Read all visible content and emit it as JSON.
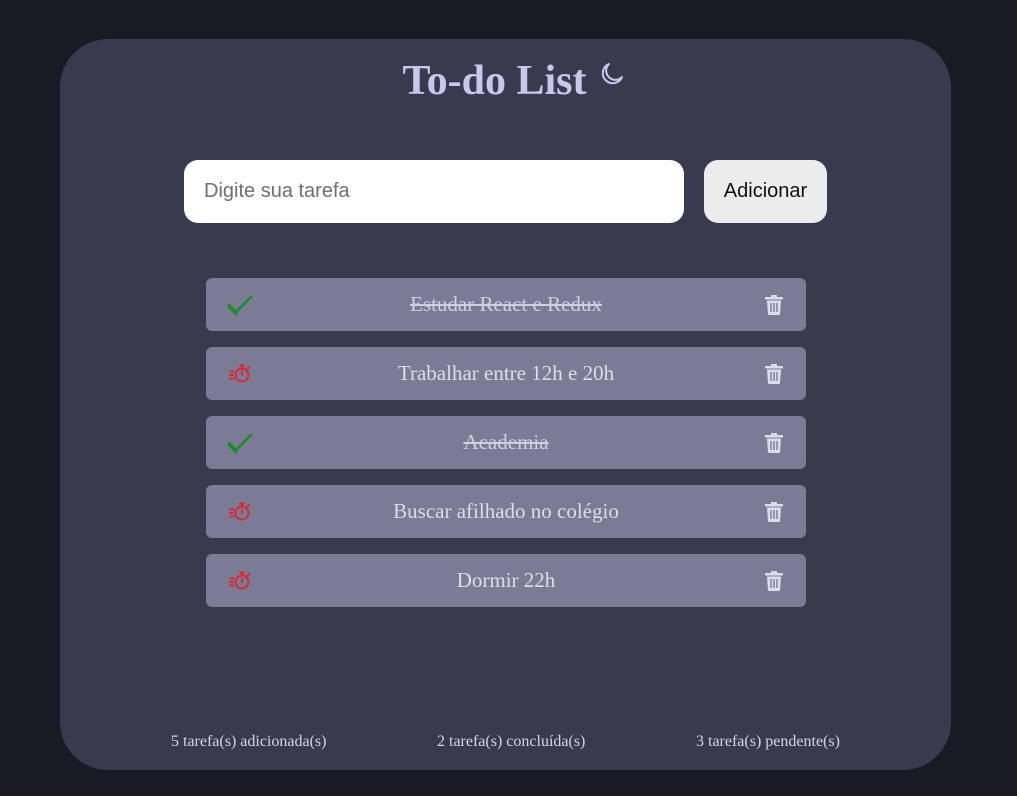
{
  "header": {
    "title": "To-do List",
    "theme_icon": "moon-icon"
  },
  "input": {
    "placeholder": "Digite sua tarefa",
    "value": ""
  },
  "add_button_label": "Adicionar",
  "tasks": [
    {
      "text": "Estudar React e Redux",
      "status": "done"
    },
    {
      "text": "Trabalhar entre 12h e 20h",
      "status": "pending"
    },
    {
      "text": "Academia",
      "status": "done"
    },
    {
      "text": "Buscar afilhado no colégio",
      "status": "pending"
    },
    {
      "text": "Dormir 22h",
      "status": "pending"
    }
  ],
  "footer": {
    "added": "5 tarefa(s) adicionada(s)",
    "done": "2 tarefa(s) concluída(s)",
    "pending": "3 tarefa(s) pendente(s)"
  },
  "colors": {
    "done_icon": "#1e8a2e",
    "pending_icon": "#d62a3a",
    "delete_icon": "#dcdcf0"
  }
}
